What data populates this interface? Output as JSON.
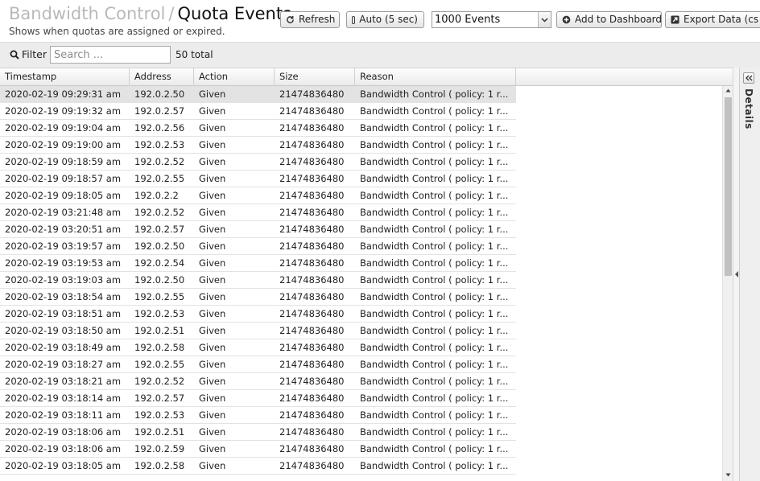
{
  "header": {
    "breadcrumb_parent": "Bandwidth Control",
    "breadcrumb_separator": "/",
    "title": "Quota Events",
    "subtitle": "Shows when quotas are assigned or expired."
  },
  "toolbar": {
    "refresh_label": "Refresh",
    "auto_label": "Auto (5 sec)",
    "events_select_value": "1000 Events",
    "add_dashboard_label": "Add to Dashboard",
    "export_label": "Export Data (cs"
  },
  "filter": {
    "label": "Filter",
    "placeholder": "Search ...",
    "value": "",
    "total": "50 total"
  },
  "grid": {
    "columns": [
      "Timestamp",
      "Address",
      "Action",
      "Size",
      "Reason"
    ],
    "rows": [
      [
        "2020-02-19 09:29:31 am",
        "192.0.2.50",
        "Given",
        "21474836480",
        "Bandwidth Control ( policy: 1 r..."
      ],
      [
        "2020-02-19 09:19:32 am",
        "192.0.2.57",
        "Given",
        "21474836480",
        "Bandwidth Control ( policy: 1 r..."
      ],
      [
        "2020-02-19 09:19:04 am",
        "192.0.2.56",
        "Given",
        "21474836480",
        "Bandwidth Control ( policy: 1 r..."
      ],
      [
        "2020-02-19 09:19:00 am",
        "192.0.2.53",
        "Given",
        "21474836480",
        "Bandwidth Control ( policy: 1 r..."
      ],
      [
        "2020-02-19 09:18:59 am",
        "192.0.2.52",
        "Given",
        "21474836480",
        "Bandwidth Control ( policy: 1 r..."
      ],
      [
        "2020-02-19 09:18:57 am",
        "192.0.2.55",
        "Given",
        "21474836480",
        "Bandwidth Control ( policy: 1 r..."
      ],
      [
        "2020-02-19 09:18:05 am",
        "192.0.2.2",
        "Given",
        "21474836480",
        "Bandwidth Control ( policy: 1 r..."
      ],
      [
        "2020-02-19 03:21:48 am",
        "192.0.2.52",
        "Given",
        "21474836480",
        "Bandwidth Control ( policy: 1 r..."
      ],
      [
        "2020-02-19 03:20:51 am",
        "192.0.2.57",
        "Given",
        "21474836480",
        "Bandwidth Control ( policy: 1 r..."
      ],
      [
        "2020-02-19 03:19:57 am",
        "192.0.2.50",
        "Given",
        "21474836480",
        "Bandwidth Control ( policy: 1 r..."
      ],
      [
        "2020-02-19 03:19:53 am",
        "192.0.2.54",
        "Given",
        "21474836480",
        "Bandwidth Control ( policy: 1 r..."
      ],
      [
        "2020-02-19 03:19:03 am",
        "192.0.2.50",
        "Given",
        "21474836480",
        "Bandwidth Control ( policy: 1 r..."
      ],
      [
        "2020-02-19 03:18:54 am",
        "192.0.2.55",
        "Given",
        "21474836480",
        "Bandwidth Control ( policy: 1 r..."
      ],
      [
        "2020-02-19 03:18:51 am",
        "192.0.2.53",
        "Given",
        "21474836480",
        "Bandwidth Control ( policy: 1 r..."
      ],
      [
        "2020-02-19 03:18:50 am",
        "192.0.2.51",
        "Given",
        "21474836480",
        "Bandwidth Control ( policy: 1 r..."
      ],
      [
        "2020-02-19 03:18:49 am",
        "192.0.2.58",
        "Given",
        "21474836480",
        "Bandwidth Control ( policy: 1 r..."
      ],
      [
        "2020-02-19 03:18:27 am",
        "192.0.2.55",
        "Given",
        "21474836480",
        "Bandwidth Control ( policy: 1 r..."
      ],
      [
        "2020-02-19 03:18:21 am",
        "192.0.2.52",
        "Given",
        "21474836480",
        "Bandwidth Control ( policy: 1 r..."
      ],
      [
        "2020-02-19 03:18:14 am",
        "192.0.2.57",
        "Given",
        "21474836480",
        "Bandwidth Control ( policy: 1 r..."
      ],
      [
        "2020-02-19 03:18:11 am",
        "192.0.2.53",
        "Given",
        "21474836480",
        "Bandwidth Control ( policy: 1 r..."
      ],
      [
        "2020-02-19 03:18:06 am",
        "192.0.2.51",
        "Given",
        "21474836480",
        "Bandwidth Control ( policy: 1 r..."
      ],
      [
        "2020-02-19 03:18:06 am",
        "192.0.2.59",
        "Given",
        "21474836480",
        "Bandwidth Control ( policy: 1 r..."
      ],
      [
        "2020-02-19 03:18:05 am",
        "192.0.2.58",
        "Given",
        "21474836480",
        "Bandwidth Control ( policy: 1 r..."
      ]
    ],
    "selected_row": 0
  },
  "details": {
    "label": "Details"
  },
  "icons": {
    "refresh": "refresh-icon",
    "checkbox": "checkbox-icon",
    "dropdown": "chevron-down-icon",
    "add": "plus-icon",
    "export": "export-icon",
    "search": "search-icon",
    "collapse": "double-chevron-left-icon"
  },
  "colors": {
    "selected_row": "#e3e3e3",
    "toolbar_bg": "#ececec",
    "breadcrumb_parent": "#b9b9b9"
  }
}
